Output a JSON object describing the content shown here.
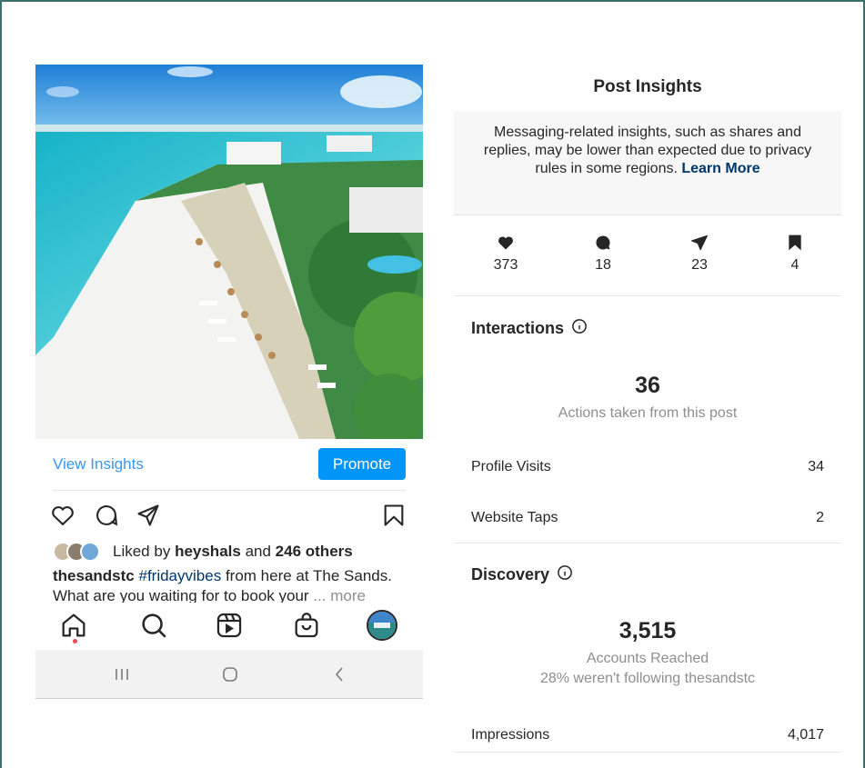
{
  "post": {
    "view_insights_label": "View Insights",
    "promote_label": "Promote",
    "liked_by_prefix": "Liked by",
    "liked_by_user": "heyshals",
    "liked_by_and": "and",
    "liked_by_others": "246 others",
    "caption_user": "thesandstc",
    "caption_hashtag": "#fridayvibes",
    "caption_text": "from here at The Sands.",
    "caption_line2": "What are you waiting for to book your",
    "caption_more": "... more"
  },
  "nav": {
    "tabs": [
      "home-icon",
      "search-icon",
      "reels-icon",
      "shop-icon",
      "profile-avatar"
    ],
    "system": [
      "recent-apps-icon",
      "home-button-icon",
      "back-icon"
    ]
  },
  "insights": {
    "title": "Post Insights",
    "notice_text": "Messaging-related insights, such as shares and replies, may be lower than expected due to privacy rules in some regions.",
    "notice_link": "Learn More",
    "stats": [
      {
        "icon": "heart-icon",
        "value": "373"
      },
      {
        "icon": "comment-icon",
        "value": "18"
      },
      {
        "icon": "share-icon",
        "value": "23"
      },
      {
        "icon": "save-icon",
        "value": "4"
      }
    ],
    "interactions": {
      "title": "Interactions",
      "total": "36",
      "total_caption": "Actions taken from this post",
      "rows": [
        {
          "label": "Profile Visits",
          "value": "34"
        },
        {
          "label": "Website Taps",
          "value": "2"
        }
      ]
    },
    "discovery": {
      "title": "Discovery",
      "total": "3,515",
      "total_caption": "Accounts Reached",
      "total_sub": "28% weren't following thesandstc",
      "rows": [
        {
          "label": "Impressions",
          "value": "4,017"
        }
      ]
    }
  },
  "colors": {
    "accent": "#0095f6",
    "link": "#3897f0",
    "frame": "#3d6f6d",
    "notification_dot": "#ed4956"
  }
}
